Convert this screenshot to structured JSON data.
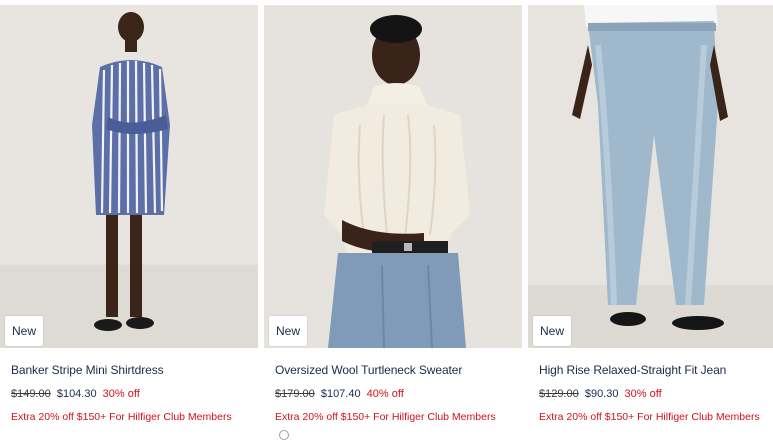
{
  "products": [
    {
      "badge": "New",
      "name": "Banker Stripe Mini Shirtdress",
      "original_price": "$149.00",
      "sale_price": "$104.30",
      "discount": "30% off",
      "promo": "Extra 20% off $150+ For Hilfiger Club Members"
    },
    {
      "badge": "New",
      "name": "Oversized Wool Turtleneck Sweater",
      "original_price": "$179.00",
      "sale_price": "$107.40",
      "discount": "40% off",
      "promo": "Extra 20% off $150+ For Hilfiger Club Members"
    },
    {
      "badge": "New",
      "name": "High Rise Relaxed-Straight Fit Jean",
      "original_price": "$129.00",
      "sale_price": "$90.30",
      "discount": "30% off",
      "promo": "Extra 20% off $150+ For Hilfiger Club Members"
    }
  ],
  "colors": {
    "name_text": "#1c2a4a",
    "sale_red": "#d2111c",
    "photo_bg": "#e7e4df"
  }
}
